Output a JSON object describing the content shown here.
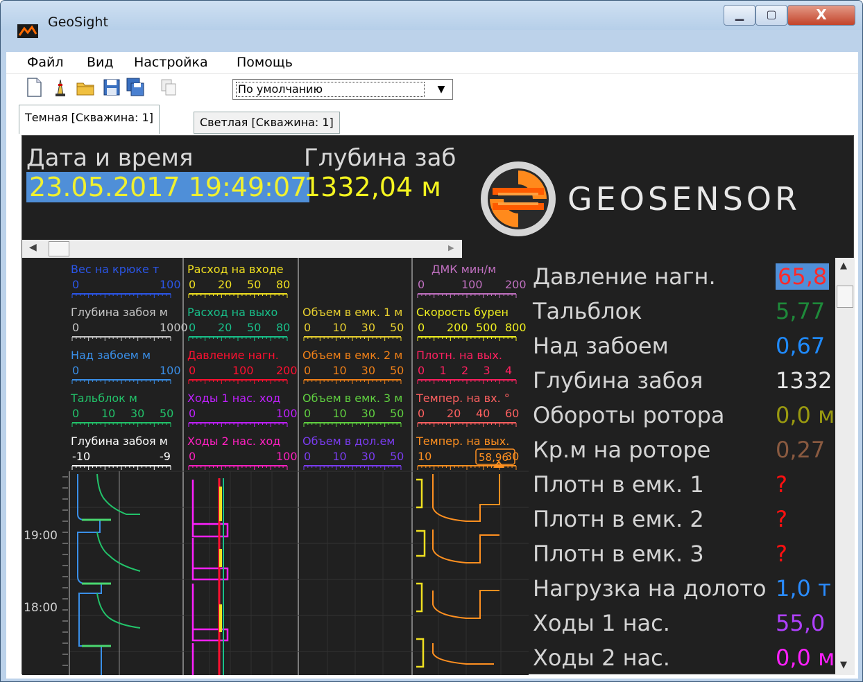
{
  "window": {
    "title": "GeoSight",
    "controls": {
      "minimize": "▁",
      "maximize": "▢",
      "close": "X"
    }
  },
  "menu": {
    "items": [
      "Файл",
      "Вид",
      "Настройка",
      "Помощь"
    ]
  },
  "toolbar": {
    "preset_value": "По умолчанию"
  },
  "tabs": [
    {
      "label": "Темная [Скважина: 1]",
      "active": true
    },
    {
      "label": "Светлая [Скважина: 1]",
      "active": false
    }
  ],
  "header": {
    "datetime_label": "Дата и время",
    "datetime_value": "23.05.2017 19:49:07",
    "depth_label": "Глубина заб",
    "depth_value": "1332,04 м",
    "logo_text": "GEOSENSOR"
  },
  "tracks": {
    "t1": [
      {
        "label": "Вес на крюке т",
        "ticks": [
          "0",
          "100"
        ],
        "color": "#2b56e8"
      },
      {
        "label": "Глубина забоя м",
        "ticks": [
          "0",
          "1000"
        ],
        "color": "#c8c8c8"
      },
      {
        "label": "Над забоем м",
        "ticks": [
          "0",
          "100"
        ],
        "color": "#3a8fe8"
      },
      {
        "label": "Тальблок м",
        "ticks": [
          "0",
          "10",
          "30",
          "50"
        ],
        "color": "#22c36a"
      },
      {
        "label": "Глубина забоя м",
        "ticks": [
          "-10",
          "-9"
        ],
        "color": "#ffffff"
      }
    ],
    "t2": [
      {
        "label": "Расход на входе",
        "ticks": [
          "0",
          "20",
          "50",
          "80"
        ],
        "color": "#f0e020"
      },
      {
        "label": "Расход на выхо",
        "ticks": [
          "0",
          "20",
          "50",
          "80"
        ],
        "color": "#18c08a"
      },
      {
        "label": "Давление нагн.",
        "ticks": [
          "0",
          "100",
          "200"
        ],
        "color": "#ff1030"
      },
      {
        "label": "Ходы 1 нас. ход",
        "ticks": [
          "0",
          "100"
        ],
        "color": "#c020ff"
      },
      {
        "label": "Ходы 2 нас. ход",
        "ticks": [
          "0",
          "100"
        ],
        "color": "#ff20c0"
      }
    ],
    "t3": [
      {
        "label": "Объем в емк. 1 м",
        "ticks": [
          "0",
          "10",
          "30",
          "50"
        ],
        "color": "#e8d030"
      },
      {
        "label": "Объем в емк. 2 м",
        "ticks": [
          "0",
          "10",
          "30",
          "50"
        ],
        "color": "#f08018"
      },
      {
        "label": "Объем в емк. 3 м",
        "ticks": [
          "0",
          "10",
          "30",
          "50"
        ],
        "color": "#60d040"
      },
      {
        "label": "Объем в дол.ем",
        "ticks": [
          "0",
          "10",
          "30",
          "50"
        ],
        "color": "#7a3cf0"
      }
    ],
    "t4": [
      {
        "label": "ДМК мин/м",
        "ticks": [
          "0",
          "100",
          "200"
        ],
        "color": "#c070c0"
      },
      {
        "label": "Скорость бурен",
        "ticks": [
          "0",
          "200",
          "500",
          "800"
        ],
        "color": "#f0f020"
      },
      {
        "label": "Плотн. на вых.",
        "ticks": [
          "0",
          "1",
          "2",
          "3",
          "4"
        ],
        "color": "#ff2060"
      },
      {
        "label": "Темпер. на вх. °",
        "ticks": [
          "0",
          "20",
          "40",
          "60"
        ],
        "color": "#ff6060"
      },
      {
        "label": "Темпер. на вых.",
        "ticks": [
          "10",
          "30"
        ],
        "color": "#ff9020",
        "current": "58,96"
      }
    ],
    "time_labels": [
      "19:00",
      "18:00"
    ]
  },
  "parameters": [
    {
      "label": "Давление нагн.",
      "value": "65,8",
      "color": "#ff2a2a"
    },
    {
      "label": "Тальблок",
      "value": "5,77",
      "color": "#1e8a3a"
    },
    {
      "label": "Над забоем",
      "value": "0,67",
      "color": "#1f8bff"
    },
    {
      "label": "Глубина забоя",
      "value": "1332",
      "color": "#e6e6e6"
    },
    {
      "label": "Обороты ротора",
      "value": "0,0 м",
      "color": "#9a9a10"
    },
    {
      "label": "Кр.м на роторе",
      "value": "0,27",
      "color": "#8a5a40"
    },
    {
      "label": "Плотн в емк. 1",
      "value": "?",
      "color": "#ff1010"
    },
    {
      "label": "Плотн в емк. 2",
      "value": "?",
      "color": "#ff1010"
    },
    {
      "label": "Плотн в емк. 3",
      "value": "?",
      "color": "#ff1010"
    },
    {
      "label": "Нагрузка на долото",
      "value": "1,0 т",
      "color": "#2a8cff"
    },
    {
      "label": "Ходы 1 нас.",
      "value": "55,0",
      "color": "#b040ff"
    },
    {
      "label": "Ходы 2 нас.",
      "value": "0,0 м",
      "color": "#ff20ff"
    }
  ]
}
